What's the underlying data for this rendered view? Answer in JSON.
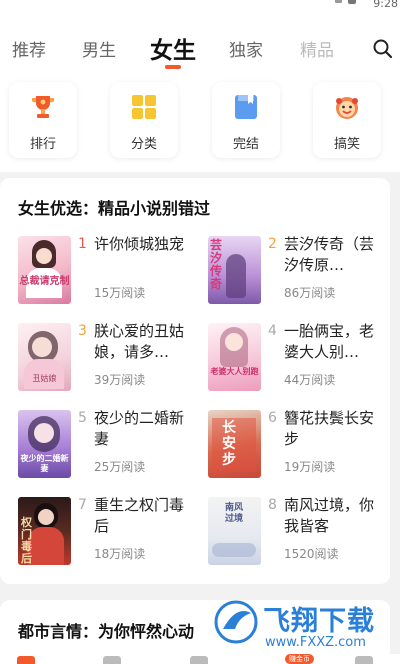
{
  "status": {
    "time": "9:28"
  },
  "tabs": [
    {
      "label": "推荐"
    },
    {
      "label": "男生"
    },
    {
      "label": "女生"
    },
    {
      "label": "独家"
    },
    {
      "label": "精品"
    }
  ],
  "categories": [
    {
      "label": "排行",
      "icon": "trophy-icon"
    },
    {
      "label": "分类",
      "icon": "grid-icon"
    },
    {
      "label": "完结",
      "icon": "book-icon"
    },
    {
      "label": "搞笑",
      "icon": "funny-face-icon"
    }
  ],
  "section1": {
    "title": "女生优选：精品小说别错过",
    "books": [
      {
        "rank": "1",
        "title": "许你倾城独宠",
        "reads": "15万阅读",
        "cover_text": "总裁请克制"
      },
      {
        "rank": "2",
        "title": "芸汐传奇（芸汐传原…",
        "reads": "86万阅读",
        "cover_text": "芸汐传奇"
      },
      {
        "rank": "3",
        "title": "朕心爱的丑姑娘，请多…",
        "reads": "39万阅读",
        "cover_text": "丑姑娘"
      },
      {
        "rank": "4",
        "title": "一胎俩宝，老婆大人别…",
        "reads": "44万阅读",
        "cover_text": "老婆大人别跑"
      },
      {
        "rank": "5",
        "title": "夜少的二婚新妻",
        "reads": "25万阅读",
        "cover_text": "夜少的二婚新妻"
      },
      {
        "rank": "6",
        "title": "簪花扶鬓长安步",
        "reads": "19万阅读",
        "cover_text": "长安步"
      },
      {
        "rank": "7",
        "title": "重生之权门毒后",
        "reads": "18万阅读",
        "cover_text": "权门毒后"
      },
      {
        "rank": "8",
        "title": "南风过境，你我皆客",
        "reads": "1520阅读",
        "cover_text": "南风过境"
      }
    ]
  },
  "section2": {
    "title": "都市言情：为你怦然心动"
  },
  "watermark": {
    "text": "飞翔下载",
    "url": "www.FXXZ.com"
  },
  "nav": {
    "badge": "赚金币"
  },
  "colors": {
    "accent": "#f25a2b",
    "rank_red": "#e85a4f",
    "rank_orange": "#f3a33a",
    "rank_gray": "#aaaaaa"
  }
}
